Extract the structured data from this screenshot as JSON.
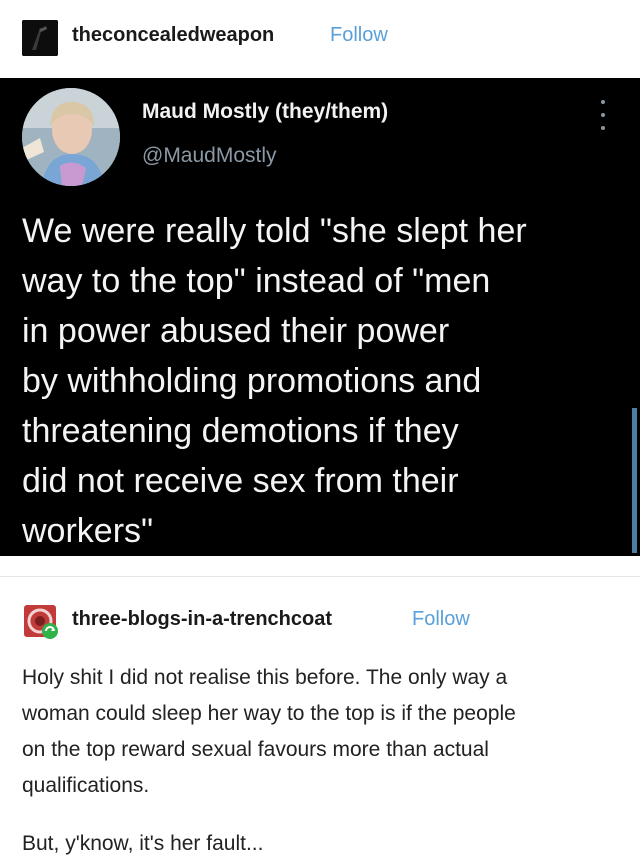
{
  "post_header": {
    "username": "theconcealedweapon",
    "follow_label": "Follow"
  },
  "tweet": {
    "display_name": "Maud Mostly (they/them)",
    "handle": "@MaudMostly",
    "text_lines": [
      "We were really told \"she slept her",
      "way to the top\" instead of \"men",
      "in power abused their power",
      "by withholding promotions and",
      "threatening demotions if they",
      "did not receive sex from their",
      "workers\""
    ]
  },
  "reblog": {
    "username": "three-blogs-in-a-trenchcoat",
    "follow_label": "Follow",
    "paragraph1_lines": [
      "Holy shit I did not realise this before. The only way a",
      "woman could sleep her way to the top is if the people",
      "on the top reward sexual favours more than actual",
      "qualifications."
    ],
    "paragraph2": "But, y'know, it's her fault..."
  },
  "colors": {
    "follow_link": "#5aa0d8",
    "tweet_background": "#000000",
    "handle_gray": "#8b98a5"
  }
}
